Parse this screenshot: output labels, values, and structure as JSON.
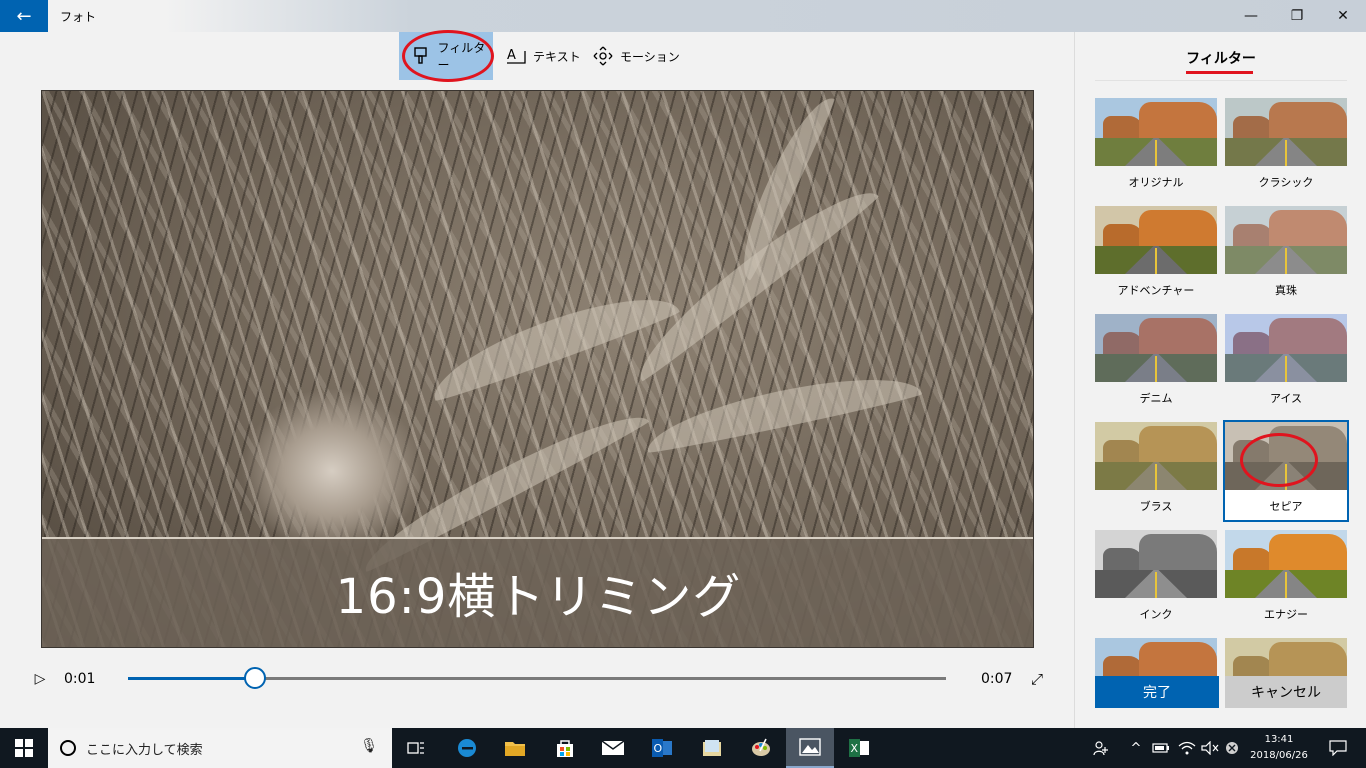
{
  "titlebar": {
    "back": "←",
    "title": "フォト",
    "minimize": "—",
    "maximize": "❐",
    "close": "✕"
  },
  "toolbar": {
    "filter": "フィルター",
    "text": "テキスト",
    "motion": "モーション"
  },
  "video": {
    "caption": "16:9横トリミング"
  },
  "playback": {
    "play": "▷",
    "current": "0:01",
    "duration": "0:07",
    "progress": 0.155,
    "fullscreen": "⤢"
  },
  "panel": {
    "title": "フィルター",
    "filters": [
      {
        "label": "オリジナル",
        "style": "original"
      },
      {
        "label": "クラシック",
        "style": "classic"
      },
      {
        "label": "アドベンチャー",
        "style": "adventure"
      },
      {
        "label": "真珠",
        "style": "pearl"
      },
      {
        "label": "デニム",
        "style": "denim"
      },
      {
        "label": "アイス",
        "style": "ice"
      },
      {
        "label": "ブラス",
        "style": "brass"
      },
      {
        "label": "セピア",
        "style": "sepia",
        "selected": true
      },
      {
        "label": "インク",
        "style": "ink"
      },
      {
        "label": "エナジー",
        "style": "energy"
      },
      {
        "label": "",
        "style": "original"
      },
      {
        "label": "",
        "style": "brass"
      }
    ],
    "done": "完了",
    "cancel": "キャンセル"
  },
  "taskbar": {
    "search_placeholder": "ここに入力して検索",
    "time": "13:41",
    "date": "2018/06/26",
    "accent": "#0063b1"
  }
}
